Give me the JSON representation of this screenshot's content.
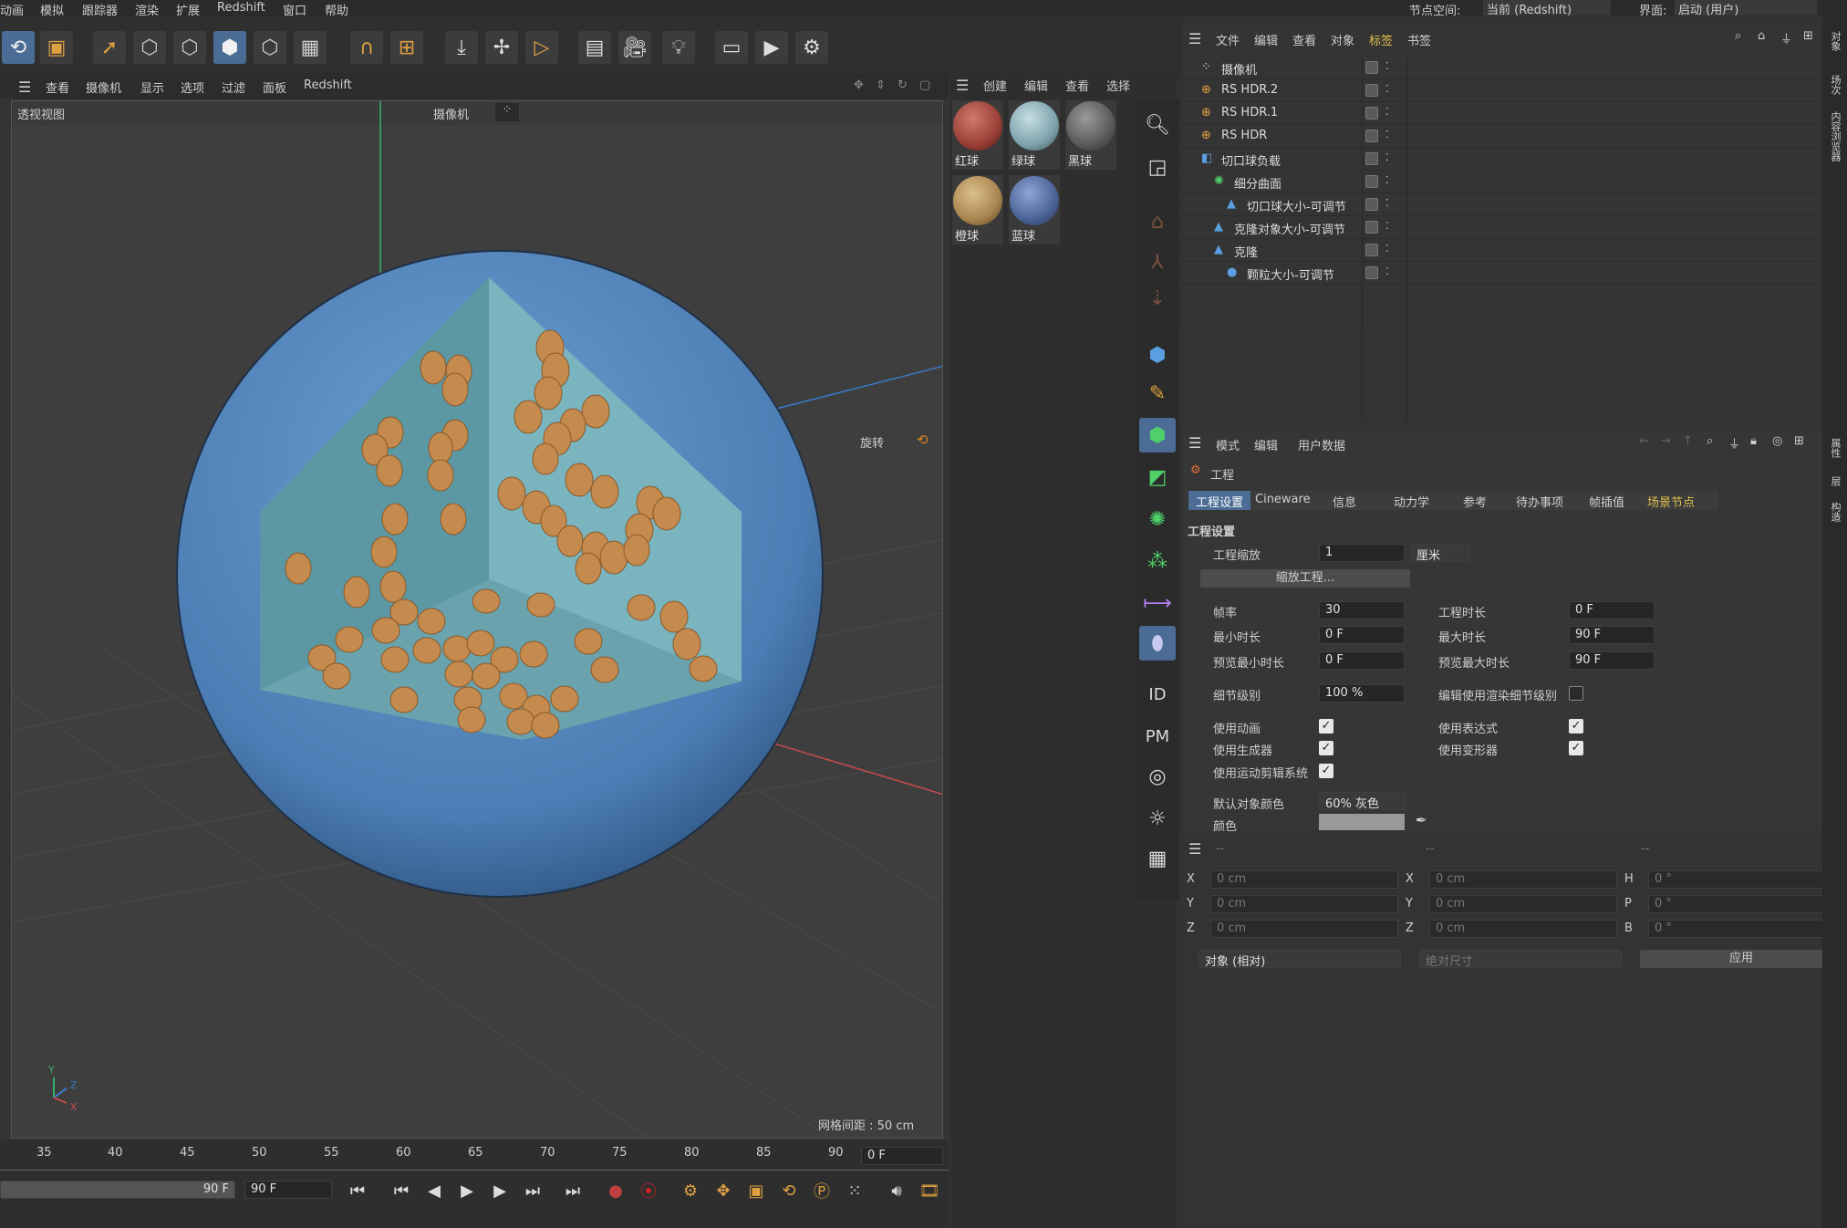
{
  "menubar": {
    "items": [
      "动画",
      "模拟",
      "跟踪器",
      "渲染",
      "扩展",
      "Redshift",
      "窗口",
      "帮助"
    ],
    "node_space_label": "节点空间:",
    "node_space_value": "当前 (Redshift)",
    "interface_label": "界面:",
    "interface_value": "启动 (用户)"
  },
  "viewport_menu": {
    "items": [
      "查看",
      "摄像机",
      "显示",
      "选项",
      "过滤",
      "面板",
      "Redshift"
    ]
  },
  "viewport": {
    "name": "透视视图",
    "camera": "摄像机",
    "rotate_label": "旋转",
    "grid_spacing": "网格间距 : 50 cm",
    "axis": {
      "y": "Y",
      "z": "Z",
      "x": "X"
    }
  },
  "material_menu": {
    "items": [
      "创建",
      "编辑",
      "查看",
      "选择"
    ]
  },
  "materials": [
    {
      "name": "红球",
      "color": "#9a3f35"
    },
    {
      "name": "绿球",
      "color": "#7fa3ad"
    },
    {
      "name": "黑球",
      "color": "#5a5a5a"
    },
    {
      "name": "橙球",
      "color": "#a9844f"
    },
    {
      "name": "蓝球",
      "color": "#4a6397"
    }
  ],
  "object_menu": {
    "items": [
      "文件",
      "编辑",
      "查看",
      "对象",
      "标签",
      "书签"
    ]
  },
  "objects": [
    {
      "name": "摄像机",
      "icon": "camera-icon",
      "indent": 0
    },
    {
      "name": "RS HDR.2",
      "icon": "light-icon",
      "indent": 0
    },
    {
      "name": "RS HDR.1",
      "icon": "light-icon",
      "indent": 0
    },
    {
      "name": "RS HDR",
      "icon": "light-icon",
      "indent": 0
    },
    {
      "name": "切口球负载",
      "icon": "null-icon",
      "indent": 0
    },
    {
      "name": "细分曲面",
      "icon": "subdivision-icon",
      "indent": 1
    },
    {
      "name": "切口球大小-可调节",
      "icon": "cloner-icon",
      "indent": 2
    },
    {
      "name": "克隆对象大小-可调节",
      "icon": "cloner-icon",
      "indent": 1
    },
    {
      "name": "克隆",
      "icon": "cloner-icon",
      "indent": 1
    },
    {
      "name": "颗粒大小-可调节",
      "icon": "sphere-icon",
      "indent": 2
    }
  ],
  "attr_menu": {
    "items": [
      "模式",
      "编辑",
      "用户数据"
    ]
  },
  "attr": {
    "object": "工程",
    "tabs": [
      "工程设置",
      "Cineware",
      "信息",
      "动力学",
      "参考",
      "待办事项",
      "帧插值",
      "场景节点"
    ],
    "section": "工程设置",
    "scale_label": "工程缩放",
    "scale_value": "1",
    "scale_unit": "厘米",
    "scale_button": "缩放工程...",
    "fps_label": "帧率",
    "fps": "30",
    "proj_len_label": "工程时长",
    "proj_len": "0 F",
    "min_label": "最小时长",
    "min": "0 F",
    "max_label": "最大时长",
    "max": "90 F",
    "pmin_label": "预览最小时长",
    "pmin": "0 F",
    "pmax_label": "预览最大时长",
    "pmax": "90 F",
    "lod_label": "细节级别",
    "lod": "100 %",
    "render_lod_label": "编辑使用渲染细节级别",
    "use_anim": "使用动画",
    "use_expr": "使用表达式",
    "use_gen": "使用生成器",
    "use_deform": "使用变形器",
    "use_motion": "使用运动剪辑系统",
    "default_color_label": "默认对象颜色",
    "default_color": "60% 灰色",
    "color_label": "颜色"
  },
  "coords": {
    "header": [
      "--",
      "--",
      "--"
    ],
    "rows": [
      [
        "X",
        "0 cm",
        "X",
        "0 cm",
        "H",
        "0 °"
      ],
      [
        "Y",
        "0 cm",
        "Y",
        "0 cm",
        "P",
        "0 °"
      ],
      [
        "Z",
        "0 cm",
        "Z",
        "0 cm",
        "B",
        "0 °"
      ]
    ],
    "mode": "对象 (相对)",
    "size_mode": "绝对尺寸",
    "apply": "应用"
  },
  "timeline": {
    "ticks": [
      "35",
      "40",
      "45",
      "50",
      "55",
      "60",
      "65",
      "70",
      "75",
      "80",
      "85",
      "90"
    ],
    "current": "0 F",
    "end_a": "90 F",
    "end_b": "90 F"
  },
  "right_strip": {
    "labels": [
      "对象",
      "场次",
      "内容浏览器",
      "属性",
      "层",
      "构造"
    ]
  }
}
